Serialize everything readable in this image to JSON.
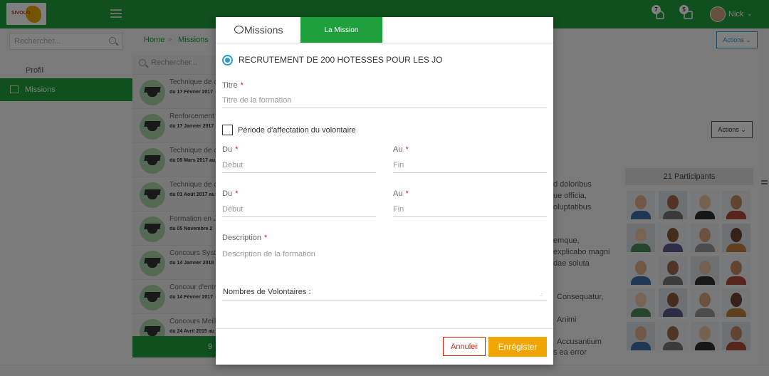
{
  "header": {
    "logo_text": "SIVOLO",
    "notifications_count": "7",
    "calendar_count": "5",
    "user_name": "Nick"
  },
  "sidebar": {
    "search_placeholder": "Rechercher...",
    "profile_label": "Profil",
    "missions_label": "Missions"
  },
  "breadcrumb": {
    "home": "Home",
    "separator": "»",
    "current": "Missions"
  },
  "actions_label": "Actions",
  "list": {
    "search_placeholder": "Rechercher...",
    "items": [
      {
        "title": "Technique de c",
        "date": "du 17 Février 2017"
      },
      {
        "title": "Renforcement c",
        "date": "du 17 Janvier 2017"
      },
      {
        "title": "Technique de c",
        "date": "du 09 Mars 2017 au"
      },
      {
        "title": "Technique de c",
        "date": "du 01 Août 2017 au"
      },
      {
        "title": "Formation en Ja",
        "date": "du 05 Novembre 2"
      },
      {
        "title": "Concours Systè",
        "date": "du 14 Janvier 2018"
      },
      {
        "title": "Concour d'entr",
        "date": "du 14 Février 2017"
      },
      {
        "title": "Concours Meille",
        "date": "du 24 Avril 2015 au"
      }
    ],
    "footer_text": "9"
  },
  "description_lines": [
    "d doloribus",
    "ue officia,",
    "oluptatibus",
    "emque,",
    "explicabo magni",
    "dae soluta",
    "Consequatur,",
    "Animi",
    "Accusantium",
    "s ea error"
  ],
  "participants": {
    "title": "21 Participants"
  },
  "modal": {
    "tab_missions": "Missions",
    "tab_mission": "La Mission",
    "mission_title": "RECRUTEMENT DE 200 HOTESSES POUR LES JO",
    "titre_label": "Titre",
    "titre_placeholder": "Titre de la formation",
    "periode_label": "Période d'affectation du volontaire",
    "du_label": "Du",
    "au_label": "Au",
    "du_placeholder": "Début",
    "au_placeholder": "Fin",
    "required_mark": "*",
    "description_label": "Description",
    "description_placeholder": "Description de la formation",
    "nombre_label": "Nombres de Volontaires :",
    "cancel_label": "Annuler",
    "save_label": "Enrégister"
  },
  "colors": {
    "brand_green": "#1ea03c",
    "save_orange": "#f0a500",
    "cancel_red": "#d9230f",
    "radio_blue": "#2a9dc7"
  },
  "icons": [
    "hamburger-icon",
    "bell-icon",
    "calendar-icon",
    "search-icon",
    "graduation-cap-icon",
    "chat-icon"
  ]
}
